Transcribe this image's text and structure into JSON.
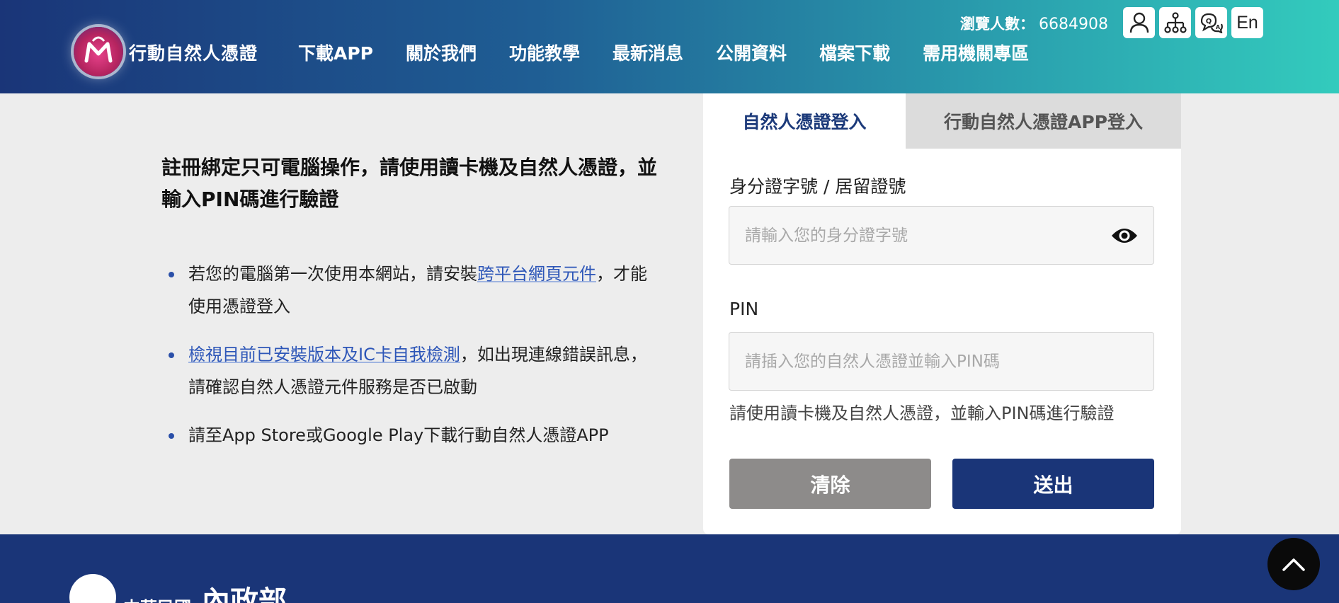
{
  "header": {
    "site_name": "行動自然人憑證",
    "nav": [
      "下載APP",
      "關於我們",
      "功能教學",
      "最新消息",
      "公開資料",
      "檔案下載",
      "需用機關專區"
    ],
    "visitors_label": "瀏覽人數：",
    "visitors_count": "6684908",
    "lang_button": "En",
    "icons": [
      "user-icon",
      "sitemap-icon",
      "chat-icon"
    ]
  },
  "intro": {
    "title": "註冊綁定只可電腦操作，請使用讀卡機及自然人憑證，並輸入PIN碼進行驗證",
    "bullets": [
      {
        "pre": "若您的電腦第一次使用本網站，請安裝",
        "link": "跨平台網頁元件",
        "post": "，才能使用憑證登入"
      },
      {
        "pre": "",
        "link": "檢視目前已安裝版本及IC卡自我檢測",
        "post": "，如出現連線錯誤訊息，請確認自然人憑證元件服務是否已啟動"
      },
      {
        "pre": "請至App Store或Google Play下載行動自然人憑證APP",
        "link": "",
        "post": ""
      }
    ]
  },
  "login": {
    "tabs": [
      "自然人憑證登入",
      "行動自然人憑證APP登入"
    ],
    "id_label": "身分證字號 / 居留證號",
    "id_placeholder": "請輸入您的身分證字號",
    "pin_label": "PIN",
    "pin_placeholder": "請插入您的自然人憑證並輸入PIN碼",
    "hint": "請使用讀卡機及自然人憑證，並輸入PIN碼進行驗證",
    "clear_label": "清除",
    "submit_label": "送出"
  },
  "footer": {
    "gov_name": "中華民國",
    "ministry": "內政部"
  },
  "colors": {
    "primary": "#1a3578",
    "link": "#2d56b8",
    "clear_button": "#8d8b8a"
  }
}
